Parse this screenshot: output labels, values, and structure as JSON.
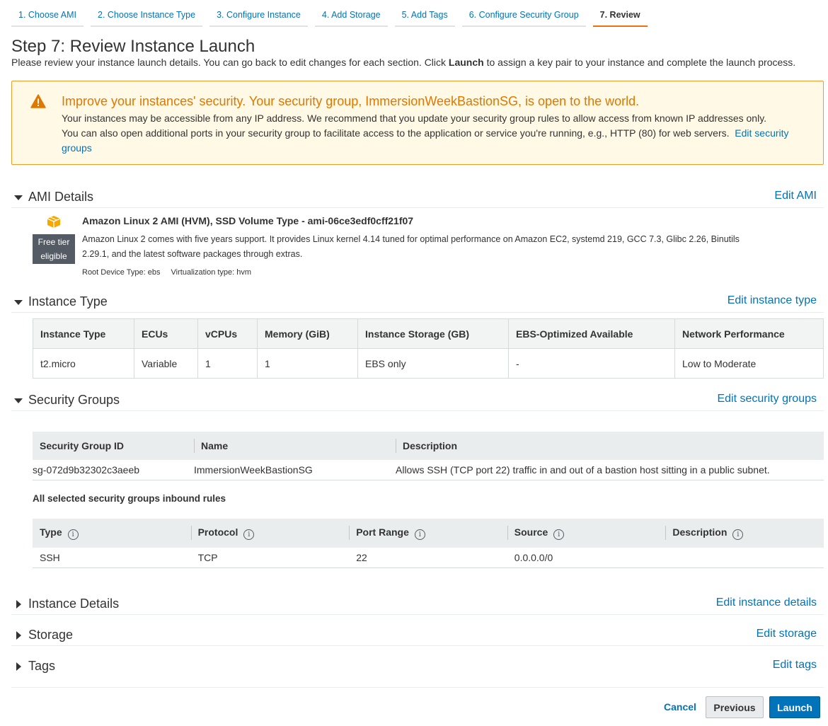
{
  "wizard": {
    "tabs": [
      {
        "label": "1. Choose AMI"
      },
      {
        "label": "2. Choose Instance Type"
      },
      {
        "label": "3. Configure Instance"
      },
      {
        "label": "4. Add Storage"
      },
      {
        "label": "5. Add Tags"
      },
      {
        "label": "6. Configure Security Group"
      },
      {
        "label": "7. Review"
      }
    ],
    "active_index": 6
  },
  "page": {
    "title": "Step 7: Review Instance Launch",
    "desc_before": "Please review your instance launch details. You can go back to edit changes for each section. Click ",
    "desc_bold": "Launch",
    "desc_after": " to assign a key pair to your instance and complete the launch process."
  },
  "warning": {
    "title": "Improve your instances' security. Your security group, ImmersionWeekBastionSG, is open to the world.",
    "line1": "Your instances may be accessible from any IP address. We recommend that you update your security group rules to allow access from known IP addresses only.",
    "line2": "You can also open additional ports in your security group to facilitate access to the application or service you're running, e.g., HTTP (80) for web servers.",
    "link": "Edit security groups",
    "color": "#e07700",
    "border": "#eb9e2c",
    "background": "#fff9e5"
  },
  "ami": {
    "title": "AMI Details",
    "edit": "Edit AMI",
    "name": "Amazon Linux 2 AMI (HVM), SSD Volume Type - ami-06ce3edf0cff21f07",
    "badge_line1": "Free tier",
    "badge_line2": "eligible",
    "description": "Amazon Linux 2 comes with five years support. It provides Linux kernel 4.14 tuned for optimal performance on Amazon EC2, systemd 219, GCC 7.3, Glibc 2.26, Binutils 2.29.1, and the latest software packages through extras.",
    "root_device": "Root Device Type: ebs",
    "virtualization": "Virtualization type: hvm",
    "icon": "cube-icon"
  },
  "instance_type": {
    "title": "Instance Type",
    "edit": "Edit instance type",
    "headers": [
      "Instance Type",
      "ECUs",
      "vCPUs",
      "Memory (GiB)",
      "Instance Storage (GB)",
      "EBS-Optimized Available",
      "Network Performance"
    ],
    "row": [
      "t2.micro",
      "Variable",
      "1",
      "1",
      "EBS only",
      "-",
      "Low to Moderate"
    ]
  },
  "security_groups": {
    "title": "Security Groups",
    "edit": "Edit security groups",
    "headers": [
      "Security Group ID",
      "Name",
      "Description"
    ],
    "row": [
      "sg-072d9b32302c3aeeb",
      "ImmersionWeekBastionSG",
      "Allows SSH (TCP port 22) traffic in and out of a bastion host sitting in a public subnet."
    ],
    "inbound_label": "All selected security groups inbound rules",
    "rules_headers": [
      "Type",
      "Protocol",
      "Port Range",
      "Source",
      "Description"
    ],
    "rules_row": [
      "SSH",
      "TCP",
      "22",
      "0.0.0.0/0",
      ""
    ],
    "info_glyph": "i"
  },
  "instance_details": {
    "title": "Instance Details",
    "edit": "Edit instance details"
  },
  "storage": {
    "title": "Storage",
    "edit": "Edit storage"
  },
  "tags": {
    "title": "Tags",
    "edit": "Edit tags"
  },
  "footer": {
    "cancel": "Cancel",
    "previous": "Previous",
    "launch": "Launch",
    "launch_color": "#0073bb"
  },
  "colors": {
    "link": "#0073bb",
    "accent_tab": "#ec7211",
    "ami_icon": "#f7a800"
  }
}
